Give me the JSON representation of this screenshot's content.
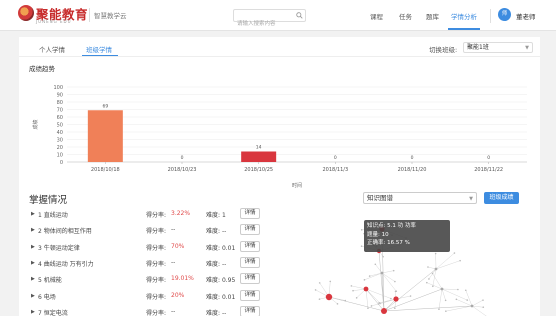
{
  "header": {
    "logo_text": "聚能教育",
    "logo_sub": "JUNENG EDU",
    "product": "智慧教学云",
    "search_placeholder": "请输入搜索内容",
    "nav": [
      {
        "label": "课程",
        "active": false
      },
      {
        "label": "任务",
        "active": false
      },
      {
        "label": "题库",
        "active": false
      },
      {
        "label": "学情分析",
        "active": true
      }
    ],
    "avatar_text": "师",
    "user_name": "董老师"
  },
  "tabs": [
    {
      "label": "个人学情",
      "active": false
    },
    {
      "label": "班级学情",
      "active": true
    }
  ],
  "class_switch": {
    "label": "切换班级:",
    "value": "聚能1班"
  },
  "score_section_title": "成绩趋势",
  "chart_data": {
    "type": "bar",
    "categories": [
      "2018/10/18",
      "2018/10/23",
      "2018/10/25",
      "2018/11/3",
      "2018/11/20",
      "2018/11/22"
    ],
    "values": [
      69,
      0,
      14,
      0,
      0,
      0
    ],
    "data_labels": [
      "69",
      "0",
      "14",
      "0",
      "0",
      "0"
    ],
    "bar_colors": [
      "#f08058",
      "#f08058",
      "#d9363e",
      "#f08058",
      "#f08058",
      "#f08058"
    ],
    "ylabel": "成绩",
    "xlabel": "时间",
    "ylim": [
      0,
      100
    ],
    "yticks": [
      0,
      10,
      20,
      30,
      40,
      50,
      60,
      70,
      80,
      90,
      100
    ],
    "grid": true
  },
  "mastery": {
    "title": "掌握情况",
    "graph_select": "知识图谱",
    "class_report_button": "班级成绩",
    "rate_label": "得分率:",
    "difficulty_label": "难度:",
    "detail_label": "详情",
    "items": [
      {
        "name": "1 直线运动",
        "rate": "3.22%",
        "rate_color": "#e04a4a",
        "difficulty": "1"
      },
      {
        "name": "2 物体间的相互作用",
        "rate": "--",
        "rate_color": "#444444",
        "difficulty": "--"
      },
      {
        "name": "3 牛顿运动定律",
        "rate": "70%",
        "rate_color": "#e04a4a",
        "difficulty": "0.01"
      },
      {
        "name": "4 曲线运动 万有引力",
        "rate": "--",
        "rate_color": "#444444",
        "difficulty": "--"
      },
      {
        "name": "5 机械能",
        "rate": "19.01%",
        "rate_color": "#e04a4a",
        "difficulty": "0.95"
      },
      {
        "name": "6 电场",
        "rate": "20%",
        "rate_color": "#e04a4a",
        "difficulty": "0.01"
      },
      {
        "name": "7 恒定电流",
        "rate": "--",
        "rate_color": "#444444",
        "difficulty": "--"
      }
    ]
  },
  "tooltip": {
    "line1": "知识点: 5.1 功 功率",
    "line2": "题量: 10",
    "line3": "正确率: 16.57 %"
  }
}
